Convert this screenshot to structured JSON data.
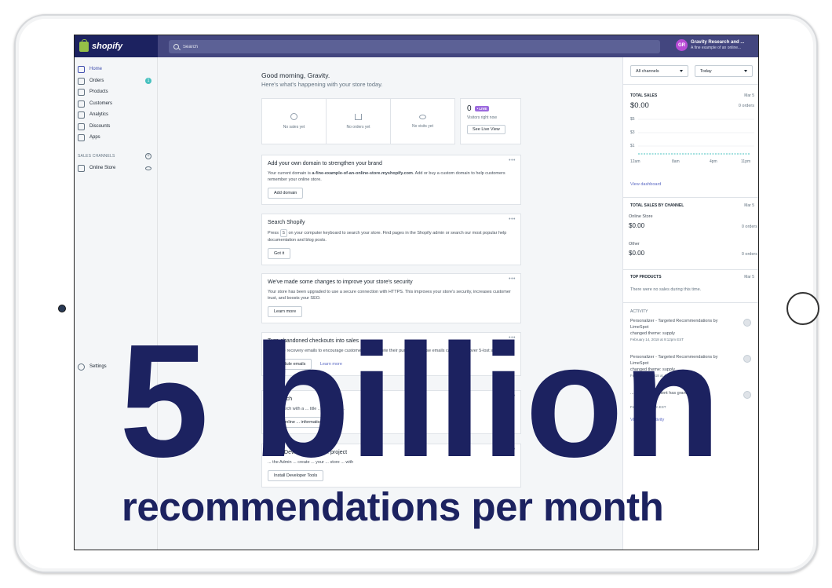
{
  "topbar": {
    "logo_text": "shopify",
    "search_placeholder": "Search",
    "avatar_initials": "GR",
    "store_name": "Gravity Research and ...",
    "store_subtitle": "A fine example of an online..."
  },
  "sidebar": {
    "items": [
      {
        "label": "Home",
        "icon": "home-icon"
      },
      {
        "label": "Orders",
        "icon": "orders-icon",
        "badge": "1"
      },
      {
        "label": "Products",
        "icon": "tag-icon"
      },
      {
        "label": "Customers",
        "icon": "person-icon"
      },
      {
        "label": "Analytics",
        "icon": "bar-chart-icon"
      },
      {
        "label": "Discounts",
        "icon": "discount-icon"
      },
      {
        "label": "Apps",
        "icon": "apps-icon"
      }
    ],
    "sales_channels_label": "SALES CHANNELS",
    "online_store_label": "Online Store",
    "settings_label": "Settings"
  },
  "main": {
    "greeting": "Good morning, Gravity.",
    "greeting_sub": "Here's what's happening with your store today.",
    "stats": {
      "no_sales": "No sales yet",
      "no_orders": "No orders yet",
      "no_visits": "No visits yet"
    },
    "live": {
      "count": "0",
      "tag": "• LIVE",
      "sub": "Visitors right now",
      "button": "See Live View"
    },
    "cards": [
      {
        "title": "Add your own domain to strengthen your brand",
        "body_pre": "Your current domain is ",
        "body_bold": "a-fine-example-of-an-online-store.myshopify.com",
        "body_post": ". Add or buy a custom domain to help customers remember your online store.",
        "button": "Add domain"
      },
      {
        "title": "Search Shopify",
        "body_pre": "Press ",
        "key": "S",
        "body_post": " on your computer keyboard to search your store. Find pages in the Shopify admin or search our most popular help documentation and blog posts.",
        "button": "Got it"
      },
      {
        "title": "We've made some changes to improve your store's security",
        "body": "Your store has been upgraded to use a secure connection with HTTPS. This improves your store's security, increases customer trust, and boosts your SEO.",
        "button": "Learn more"
      },
      {
        "title": "Turn abandoned checkouts into sales",
        "body": "Schedule recovery emails to encourage customers to complete their purchase. These emails can help recover 5-lost sales.",
        "button": "Schedule emails",
        "link": "Learn more"
      },
      {
        "title": "for search",
        "body": "store search with a ... title ... description.",
        "button": "your online ... information"
      },
      {
        "title": "...ning Dev... for ... app ... project",
        "body": "... the Admin ... create ... your ... store ... with",
        "button": "Install Developer Tools"
      }
    ]
  },
  "right_panel": {
    "channel_select": "All channels",
    "date_select": "Today",
    "total_sales_label": "TOTAL SALES",
    "total_sales_date": "Mar 5",
    "total_sales_value": "$0.00",
    "total_sales_orders": "0 orders",
    "chart_y_labels": [
      "$5",
      "$3",
      "$1"
    ],
    "chart_x_labels": [
      "12am",
      "8am",
      "4pm",
      "11pm"
    ],
    "view_dashboard": "View dashboard",
    "by_channel_label": "TOTAL SALES BY CHANNEL",
    "by_channel_date": "Mar 5",
    "online_store_label": "Online Store",
    "online_store_value": "$0.00",
    "online_store_orders": "0 orders",
    "other_label": "Other",
    "other_value": "$0.00",
    "other_orders": "0 orders",
    "top_products_label": "TOP PRODUCTS",
    "top_products_date": "Mar 5",
    "top_products_empty": "There were no sales during this time.",
    "activity_label": "ACTIVITY",
    "activities": [
      {
        "line1": "Personalizer - Targeted Recommendations by",
        "line2": "LimeSpot",
        "line3": "changed theme: supply",
        "time": "February 14, 2018 at 9:12pm EST"
      },
      {
        "line1": "Personalizer - Targeted Recommendations by",
        "line2": "LimeSpot",
        "line3": "changed theme: supply",
        "time": "February 13, 2018 at 4:05pm EST"
      },
      {
        "line1": "...and Development has granted",
        "line2": "",
        "line3": "",
        "time": "February ... 12am EST"
      }
    ],
    "view_all": "View all ... activity"
  },
  "overlay": {
    "headline": "5 billion",
    "subline": "recommendations per month",
    "color": "#1c2260"
  }
}
